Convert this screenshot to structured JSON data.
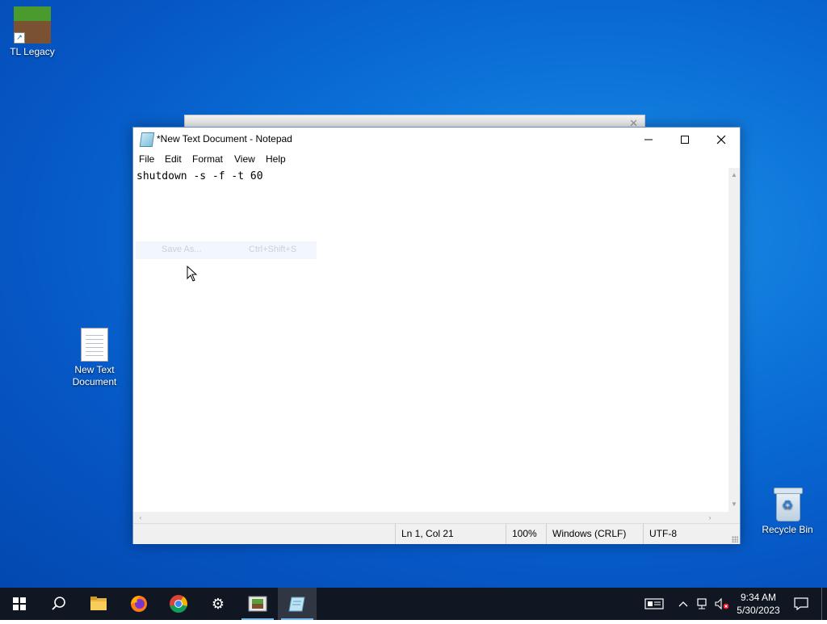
{
  "desktop": {
    "icons": {
      "tl_legacy": "TL Legacy",
      "new_text_document": "New Text Document",
      "recycle_bin": "Recycle Bin"
    }
  },
  "notepad": {
    "title": "*New Text Document - Notepad",
    "menu": [
      "File",
      "Edit",
      "Format",
      "View",
      "Help"
    ],
    "content": "shutdown -s -f -t 60",
    "ghost_menu": {
      "label": "Save As...",
      "shortcut": "Ctrl+Shift+S"
    },
    "status": {
      "position": "Ln 1, Col 21",
      "zoom": "100%",
      "line_endings": "Windows (CRLF)",
      "encoding": "UTF-8"
    }
  },
  "taskbar": {
    "apps": [
      "start-icon",
      "search-icon",
      "file-explorer-icon",
      "firefox-icon",
      "chrome-icon",
      "settings-icon",
      "minecraft-launcher-icon",
      "notepad-icon"
    ],
    "active_app": "notepad-icon",
    "clock": {
      "time": "9:34 AM",
      "date": "5/30/2023"
    }
  },
  "colors": {
    "desktop_blue": "#0a6fd6",
    "taskbar": "#101723",
    "accent": "#76b9ed"
  }
}
